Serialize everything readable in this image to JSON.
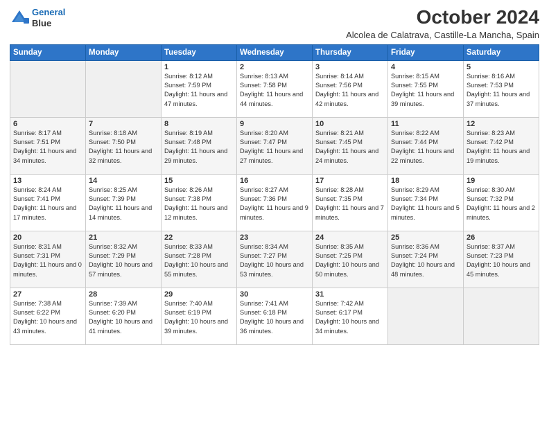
{
  "header": {
    "logo_line1": "General",
    "logo_line2": "Blue",
    "month": "October 2024",
    "location": "Alcolea de Calatrava, Castille-La Mancha, Spain"
  },
  "weekdays": [
    "Sunday",
    "Monday",
    "Tuesday",
    "Wednesday",
    "Thursday",
    "Friday",
    "Saturday"
  ],
  "weeks": [
    [
      {
        "day": "",
        "info": ""
      },
      {
        "day": "",
        "info": ""
      },
      {
        "day": "1",
        "info": "Sunrise: 8:12 AM\nSunset: 7:59 PM\nDaylight: 11 hours and 47 minutes."
      },
      {
        "day": "2",
        "info": "Sunrise: 8:13 AM\nSunset: 7:58 PM\nDaylight: 11 hours and 44 minutes."
      },
      {
        "day": "3",
        "info": "Sunrise: 8:14 AM\nSunset: 7:56 PM\nDaylight: 11 hours and 42 minutes."
      },
      {
        "day": "4",
        "info": "Sunrise: 8:15 AM\nSunset: 7:55 PM\nDaylight: 11 hours and 39 minutes."
      },
      {
        "day": "5",
        "info": "Sunrise: 8:16 AM\nSunset: 7:53 PM\nDaylight: 11 hours and 37 minutes."
      }
    ],
    [
      {
        "day": "6",
        "info": "Sunrise: 8:17 AM\nSunset: 7:51 PM\nDaylight: 11 hours and 34 minutes."
      },
      {
        "day": "7",
        "info": "Sunrise: 8:18 AM\nSunset: 7:50 PM\nDaylight: 11 hours and 32 minutes."
      },
      {
        "day": "8",
        "info": "Sunrise: 8:19 AM\nSunset: 7:48 PM\nDaylight: 11 hours and 29 minutes."
      },
      {
        "day": "9",
        "info": "Sunrise: 8:20 AM\nSunset: 7:47 PM\nDaylight: 11 hours and 27 minutes."
      },
      {
        "day": "10",
        "info": "Sunrise: 8:21 AM\nSunset: 7:45 PM\nDaylight: 11 hours and 24 minutes."
      },
      {
        "day": "11",
        "info": "Sunrise: 8:22 AM\nSunset: 7:44 PM\nDaylight: 11 hours and 22 minutes."
      },
      {
        "day": "12",
        "info": "Sunrise: 8:23 AM\nSunset: 7:42 PM\nDaylight: 11 hours and 19 minutes."
      }
    ],
    [
      {
        "day": "13",
        "info": "Sunrise: 8:24 AM\nSunset: 7:41 PM\nDaylight: 11 hours and 17 minutes."
      },
      {
        "day": "14",
        "info": "Sunrise: 8:25 AM\nSunset: 7:39 PM\nDaylight: 11 hours and 14 minutes."
      },
      {
        "day": "15",
        "info": "Sunrise: 8:26 AM\nSunset: 7:38 PM\nDaylight: 11 hours and 12 minutes."
      },
      {
        "day": "16",
        "info": "Sunrise: 8:27 AM\nSunset: 7:36 PM\nDaylight: 11 hours and 9 minutes."
      },
      {
        "day": "17",
        "info": "Sunrise: 8:28 AM\nSunset: 7:35 PM\nDaylight: 11 hours and 7 minutes."
      },
      {
        "day": "18",
        "info": "Sunrise: 8:29 AM\nSunset: 7:34 PM\nDaylight: 11 hours and 5 minutes."
      },
      {
        "day": "19",
        "info": "Sunrise: 8:30 AM\nSunset: 7:32 PM\nDaylight: 11 hours and 2 minutes."
      }
    ],
    [
      {
        "day": "20",
        "info": "Sunrise: 8:31 AM\nSunset: 7:31 PM\nDaylight: 11 hours and 0 minutes."
      },
      {
        "day": "21",
        "info": "Sunrise: 8:32 AM\nSunset: 7:29 PM\nDaylight: 10 hours and 57 minutes."
      },
      {
        "day": "22",
        "info": "Sunrise: 8:33 AM\nSunset: 7:28 PM\nDaylight: 10 hours and 55 minutes."
      },
      {
        "day": "23",
        "info": "Sunrise: 8:34 AM\nSunset: 7:27 PM\nDaylight: 10 hours and 53 minutes."
      },
      {
        "day": "24",
        "info": "Sunrise: 8:35 AM\nSunset: 7:25 PM\nDaylight: 10 hours and 50 minutes."
      },
      {
        "day": "25",
        "info": "Sunrise: 8:36 AM\nSunset: 7:24 PM\nDaylight: 10 hours and 48 minutes."
      },
      {
        "day": "26",
        "info": "Sunrise: 8:37 AM\nSunset: 7:23 PM\nDaylight: 10 hours and 45 minutes."
      }
    ],
    [
      {
        "day": "27",
        "info": "Sunrise: 7:38 AM\nSunset: 6:22 PM\nDaylight: 10 hours and 43 minutes."
      },
      {
        "day": "28",
        "info": "Sunrise: 7:39 AM\nSunset: 6:20 PM\nDaylight: 10 hours and 41 minutes."
      },
      {
        "day": "29",
        "info": "Sunrise: 7:40 AM\nSunset: 6:19 PM\nDaylight: 10 hours and 39 minutes."
      },
      {
        "day": "30",
        "info": "Sunrise: 7:41 AM\nSunset: 6:18 PM\nDaylight: 10 hours and 36 minutes."
      },
      {
        "day": "31",
        "info": "Sunrise: 7:42 AM\nSunset: 6:17 PM\nDaylight: 10 hours and 34 minutes."
      },
      {
        "day": "",
        "info": ""
      },
      {
        "day": "",
        "info": ""
      }
    ]
  ]
}
